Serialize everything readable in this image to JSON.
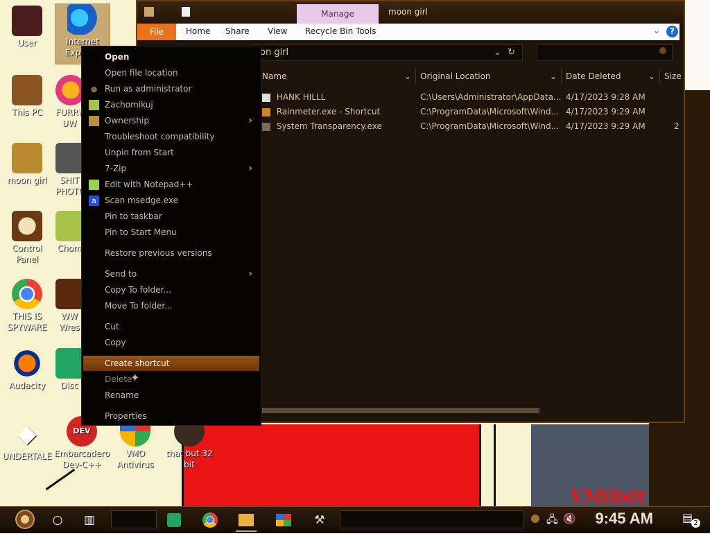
{
  "desktop": {
    "icons": [
      {
        "label": "User"
      },
      {
        "label": "Internet Explorer"
      },
      {
        "label": "This PC"
      },
      {
        "label": "FURRY UW"
      },
      {
        "label": "moon girl"
      },
      {
        "label": "SHIT PHOTO"
      },
      {
        "label": "Control Panel"
      },
      {
        "label": "Chom"
      },
      {
        "label": "THIS IS SPYWARE"
      },
      {
        "label": "WW Wres"
      },
      {
        "label": "Audacity"
      },
      {
        "label": "Disc"
      },
      {
        "label": "UNDERTALE"
      },
      {
        "label": "Embarcadero Dev-C++"
      },
      {
        "label": "VMO Antivirus"
      },
      {
        "label": "that but 32 bit"
      }
    ],
    "wordmark": "VM0b0t"
  },
  "explorer": {
    "title": "moon girl",
    "manage_tab": "Manage",
    "ribbon_tabs": [
      "File",
      "Home",
      "Share",
      "View",
      "Recycle Bin Tools"
    ],
    "address": "on girl",
    "columns": [
      "Name",
      "Original Location",
      "Date Deleted",
      "Size"
    ],
    "rows": [
      {
        "name": "HANK HILLL",
        "location": "C:\\Users\\Administrator\\AppData...",
        "date": "4/17/2023 9:28 AM",
        "size": ""
      },
      {
        "name": "Rainmeter.exe - Shortcut",
        "location": "C:\\ProgramData\\Microsoft\\Wind...",
        "date": "4/17/2023 9:29 AM",
        "size": ""
      },
      {
        "name": "System Transparency.exe",
        "location": "C:\\ProgramData\\Microsoft\\Wind...",
        "date": "4/17/2023 9:29 AM",
        "size": "2"
      }
    ]
  },
  "context_menu": {
    "items": [
      {
        "label": "Open"
      },
      {
        "label": "Open file location"
      },
      {
        "label": "Run as administrator"
      },
      {
        "label": "Zachomikuj"
      },
      {
        "label": "Ownership"
      },
      {
        "label": "Troubleshoot compatibility"
      },
      {
        "label": "Unpin from Start"
      },
      {
        "label": "7-Zip"
      },
      {
        "label": "Edit with Notepad++"
      },
      {
        "label": "Scan msedge.exe"
      },
      {
        "label": "Pin to taskbar"
      },
      {
        "label": "Pin to Start Menu"
      },
      {
        "label": "Restore previous versions"
      },
      {
        "label": "Send to"
      },
      {
        "label": "Copy To folder..."
      },
      {
        "label": "Move To folder..."
      },
      {
        "label": "Cut"
      },
      {
        "label": "Copy"
      },
      {
        "label": "Create shortcut"
      },
      {
        "label": "Delete"
      },
      {
        "label": "Rename"
      },
      {
        "label": "Properties"
      }
    ]
  },
  "taskbar": {
    "clock": "9:45 AM",
    "notification_count": "2"
  },
  "colors": {
    "accent": "#e7741b",
    "highlight": "#9a5416",
    "manage": "#e9c7ea"
  }
}
